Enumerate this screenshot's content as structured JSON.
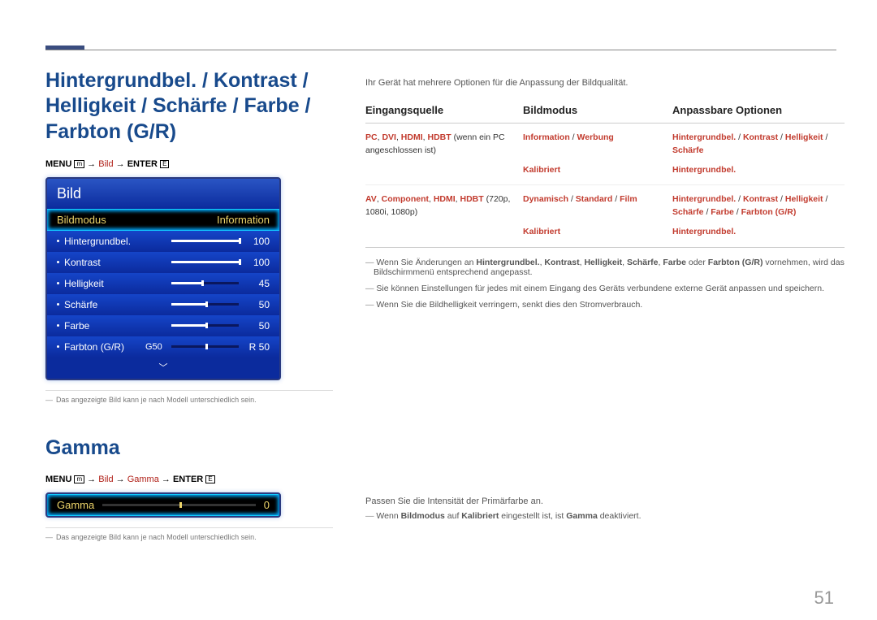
{
  "page_number": "51",
  "heading_main": "Hintergrundbel. / Kontrast / Helligkeit / Schärfe / Farbe / Farbton (G/R)",
  "menupath1": {
    "prefix": "MENU",
    "icon": "m",
    "part1": "Bild",
    "suffix": "ENTER",
    "icon2": "E"
  },
  "panel1": {
    "title": "Bild",
    "hilite_l": "Bildmodus",
    "hilite_r": "Information",
    "rows": [
      {
        "label": "Hintergrundbel.",
        "val": "100",
        "pct": 100,
        "pre": ""
      },
      {
        "label": "Kontrast",
        "val": "100",
        "pct": 100,
        "pre": ""
      },
      {
        "label": "Helligkeit",
        "val": "45",
        "pct": 45,
        "pre": ""
      },
      {
        "label": "Schärfe",
        "val": "50",
        "pct": 50,
        "pre": ""
      },
      {
        "label": "Farbe",
        "val": "50",
        "pct": 50,
        "pre": ""
      },
      {
        "label": "Farbton (G/R)",
        "val": "R 50",
        "pct": 50,
        "pre": "G50",
        "center": true
      }
    ]
  },
  "footnote1": "Das angezeigte Bild kann je nach Modell unterschiedlich sein.",
  "heading_gamma": "Gamma",
  "menupath2": {
    "prefix": "MENU",
    "icon": "m",
    "part1": "Bild",
    "part2": "Gamma",
    "suffix": "ENTER",
    "icon2": "E"
  },
  "panel2": {
    "label": "Gamma",
    "val": "0"
  },
  "footnote2": "Das angezeigte Bild kann je nach Modell unterschiedlich sein.",
  "intro": "Ihr Gerät hat mehrere Optionen für die Anpassung der Bildqualität.",
  "table": {
    "head": [
      "Eingangsquelle",
      "Bildmodus",
      "Anpassbare Optionen"
    ],
    "rows": [
      {
        "src_html": "<span class='red b'>PC</span>, <span class='red b'>DVI</span>, <span class='red b'>HDMI</span>, <span class='red b'>HDBT</span> (wenn ein PC angeschlossen ist)",
        "mode_html": "<span class='red b'>Information</span> / <span class='red b'>Werbung</span>",
        "opt_html": "<span class='red b'>Hintergrundbel.</span> / <span class='red b'>Kontrast</span> / <span class='red b'>Helligkeit</span> / <span class='red b'>Schärfe</span>"
      },
      {
        "src_html": "",
        "mode_html": "<span class='red b'>Kalibriert</span>",
        "opt_html": "<span class='red b'>Hintergrundbel.</span>"
      },
      {
        "src_html": "<span class='red b'>AV</span>, <span class='red b'>Component</span>, <span class='red b'>HDMI</span>, <span class='red b'>HDBT</span> (720p, 1080i, 1080p)",
        "mode_html": "<span class='red b'>Dynamisch</span> / <span class='red b'>Standard</span> / <span class='red b'>Film</span>",
        "opt_html": "<span class='red b'>Hintergrundbel.</span> / <span class='red b'>Kontrast</span> / <span class='red b'>Helligkeit</span> / <span class='red b'>Schärfe</span> / <span class='red b'>Farbe</span> / <span class='red b'>Farbton (G/R)</span>"
      },
      {
        "src_html": "",
        "mode_html": "<span class='red b'>Kalibriert</span>",
        "opt_html": "<span class='red b'>Hintergrundbel.</span>"
      }
    ]
  },
  "notes": [
    "Wenn Sie Änderungen an <span class='b'>Hintergrundbel.</span>, <span class='b'>Kontrast</span>, <span class='b'>Helligkeit</span>, <span class='b'>Schärfe</span>, <span class='b'>Farbe</span> oder <span class='b'>Farbton (G/R)</span> vornehmen, wird das Bildschirmmenü entsprechend angepasst.",
    "Sie können Einstellungen für jedes mit einem Eingang des Geräts verbundene externe Gerät anpassen und speichern.",
    "Wenn Sie die Bildhelligkeit verringern, senkt dies den Stromverbrauch."
  ],
  "gamma_desc": "Passen Sie die Intensität der Primärfarbe an.",
  "gamma_note": "Wenn <span class='b'>Bildmodus</span> auf <span class='b'>Kalibriert</span> eingestellt ist, ist <span class='b'>Gamma</span> deaktiviert."
}
